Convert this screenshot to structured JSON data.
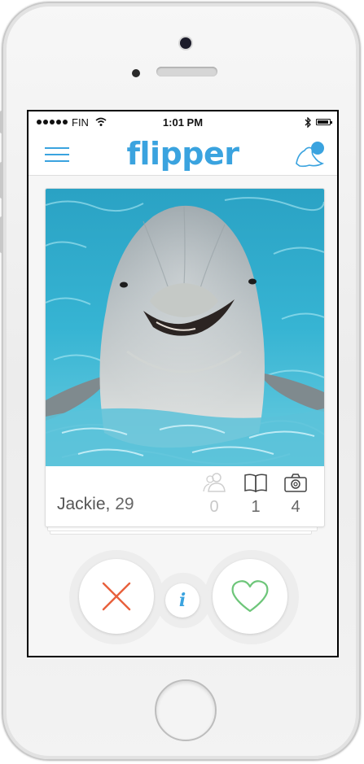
{
  "status_bar": {
    "carrier": "FIN",
    "time": "1:01 PM"
  },
  "nav": {
    "logo": "flipper",
    "menu_icon": "hamburger-menu-icon",
    "profile_icon": "dolphin-profile-icon"
  },
  "card": {
    "name": "Jackie",
    "separator": ", ",
    "age": "29",
    "photo_description": "dolphin-photo",
    "stats": [
      {
        "icon": "friends-icon",
        "value": "0"
      },
      {
        "icon": "book-icon",
        "value": "1"
      },
      {
        "icon": "camera-icon",
        "value": "4"
      }
    ]
  },
  "actions": {
    "dislike_icon": "x-icon",
    "info_label": "i",
    "like_icon": "heart-icon"
  },
  "colors": {
    "accent": "#3aa3df",
    "dislike": "#e8603c",
    "like": "#6ec67a"
  }
}
